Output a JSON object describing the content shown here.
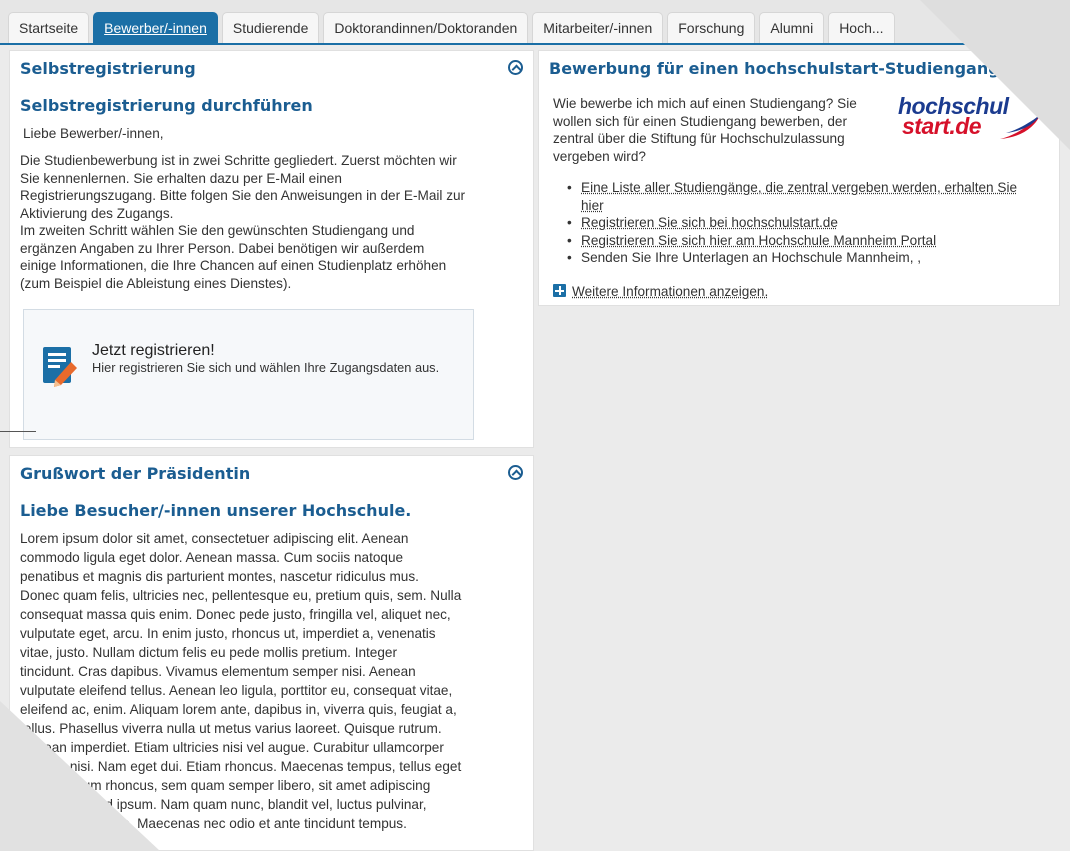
{
  "tabs": [
    {
      "label": "Startseite"
    },
    {
      "label": "Bewerber/-innen",
      "active": true
    },
    {
      "label": "Studierende"
    },
    {
      "label": "Doktorandinnen/Doktoranden"
    },
    {
      "label": "Mitarbeiter/-innen"
    },
    {
      "label": "Forschung"
    },
    {
      "label": "Alumni"
    },
    {
      "label": "Hoch..."
    }
  ],
  "selbst": {
    "title": "Selbstregistrierung",
    "subtitle": "Selbstregistrierung durchführen",
    "greeting": "Liebe Bewerber/-innen,",
    "para": [
      "Die Studienbewerbung ist in zwei Schritte gegliedert. Zuerst möchten wir",
      "Sie kennenlernen. Sie erhalten dazu per E-Mail einen",
      "Registrierungszugang. Bitte folgen Sie den Anweisungen in der E-Mail zur",
      "Aktivierung des Zugangs.",
      "Im zweiten Schritt wählen Sie den gewünschten Studiengang und",
      "ergänzen Angaben zu Ihrer Person. Dabei benötigen wir außerdem",
      "einige Informationen, die Ihre Chancen auf einen Studienplatz erhöhen",
      "(zum Beispiel die Ableistung eines Dienstes)."
    ],
    "register_title": "Jetzt registrieren!",
    "register_desc": "Hier registrieren Sie sich und wählen Ihre Zugangsdaten aus.",
    "register_icon": "edit-form-icon"
  },
  "hochschulstart": {
    "title": "Bewerbung für einen hochschulstart-Studiengang",
    "intro": [
      "Wie bewerbe ich mich auf einen Studiengang? Sie",
      "wollen sich für einen Studiengang bewerben, der",
      "zentral über die Stiftung für Hochschulzulassung",
      "vergeben wird?"
    ],
    "logo_line1": "hochschul",
    "logo_line2": "start.de",
    "links": [
      "Eine Liste aller Studiengänge, die zentral vergeben werden, erhalten Sie hier",
      "Registrieren Sie sich bei hochschulstart.de",
      "Registrieren Sie sich hier am Hochschule Mannheim Portal"
    ],
    "plain_item": "Senden Sie Ihre Unterlagen an Hochschule Mannheim, ,",
    "more": "Weitere Informationen anzeigen."
  },
  "gruss": {
    "title": "Grußwort der Präsidentin",
    "subtitle": "Liebe Besucher/-innen unserer Hochschule.",
    "lines": [
      "Lorem ipsum dolor sit amet, consectetuer adipiscing elit. Aenean",
      "commodo ligula eget dolor. Aenean massa. Cum sociis natoque",
      "penatibus et magnis dis parturient montes, nascetur ridiculus mus.",
      "Donec quam felis, ultricies nec, pellentesque eu, pretium quis, sem. Nulla",
      "consequat massa quis enim. Donec pede justo, fringilla vel, aliquet nec,",
      "vulputate eget, arcu. In enim justo, rhoncus ut, imperdiet a, venenatis",
      "vitae, justo. Nullam dictum felis eu pede mollis pretium. Integer",
      "tincidunt. Cras dapibus. Vivamus elementum semper nisi. Aenean",
      "vulputate eleifend tellus. Aenean leo ligula, porttitor eu, consequat vitae,",
      "eleifend ac, enim. Aliquam lorem ante, dapibus in, viverra quis, feugiat a,",
      "tellus. Phasellus viverra nulla ut metus varius laoreet. Quisque rutrum.",
      "Aenean imperdiet. Etiam ultricies nisi vel augue. Curabitur ullamcorper",
      "ultricies nisi. Nam eget dui. Etiam rhoncus. Maecenas tempus, tellus eget",
      "condimentum rhoncus, sem quam semper libero, sit amet adipiscing",
      "sem neque sed ipsum. Nam quam nunc, blandit vel, luctus pulvinar,",
      "hendrerit id, lorem. Maecenas nec odio et ante tincidunt tempus."
    ]
  },
  "colors": {
    "accent": "#1b6fa6",
    "heading": "#1b5d91",
    "logo_blue": "#1b3b8f",
    "logo_red": "#d6112a"
  }
}
